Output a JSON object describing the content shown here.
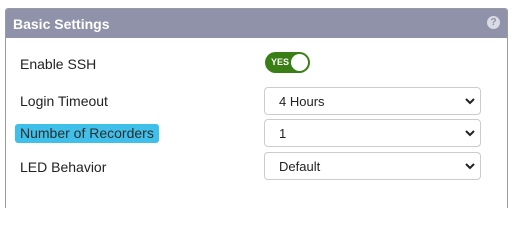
{
  "panel": {
    "title": "Basic Settings",
    "help_icon": "?"
  },
  "settings": {
    "ssh": {
      "label": "Enable SSH",
      "toggle_text": "YES",
      "enabled": true
    },
    "login_timeout": {
      "label": "Login Timeout",
      "value": "4 Hours"
    },
    "recorders": {
      "label": "Number of Recorders",
      "value": "1"
    },
    "led": {
      "label": "LED Behavior",
      "value": "Default"
    }
  },
  "colors": {
    "header_bg": "#8f92a8",
    "toggle_on": "#3a7e16",
    "highlight": "#3fc0ea"
  },
  "icons": {
    "help": "question-mark-circle",
    "select": "chevron-down"
  }
}
